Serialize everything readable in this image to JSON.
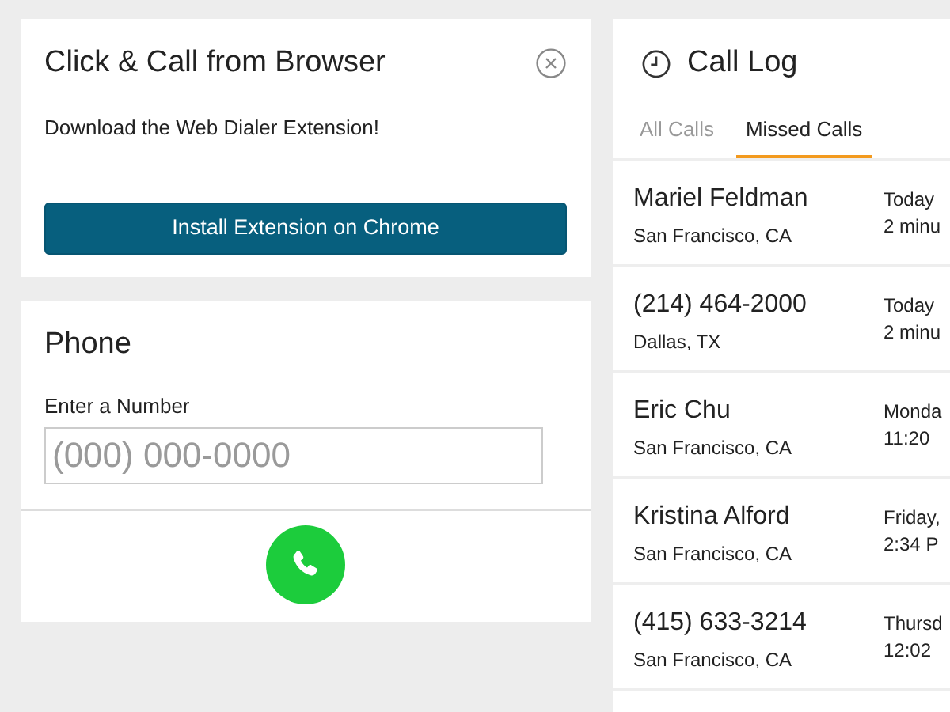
{
  "browser_card": {
    "title": "Click & Call from Browser",
    "message": "Download the Web Dialer Extension!",
    "button": "Install Extension on Chrome"
  },
  "phone_card": {
    "title": "Phone",
    "field_label": "Enter a Number",
    "placeholder": "(000) 000-0000"
  },
  "call_log": {
    "title": "Call Log",
    "tabs": [
      {
        "label": "All Calls",
        "selected": false
      },
      {
        "label": "Missed Calls",
        "selected": true
      }
    ],
    "calls": [
      {
        "name": "Mariel Feldman",
        "location": "San Francisco, CA",
        "day": "Today",
        "time": "2 minu"
      },
      {
        "name": "(214) 464-2000",
        "location": "Dallas, TX",
        "day": "Today",
        "time": "2 minu"
      },
      {
        "name": "Eric Chu",
        "location": "San Francisco, CA",
        "day": "Monda",
        "time": "11:20"
      },
      {
        "name": "Kristina Alford",
        "location": "San Francisco, CA",
        "day": "Friday,",
        "time": "2:34 P"
      },
      {
        "name": "(415) 633-3214",
        "location": "San Francisco, CA",
        "day": "Thursd",
        "time": "12:02"
      }
    ]
  }
}
